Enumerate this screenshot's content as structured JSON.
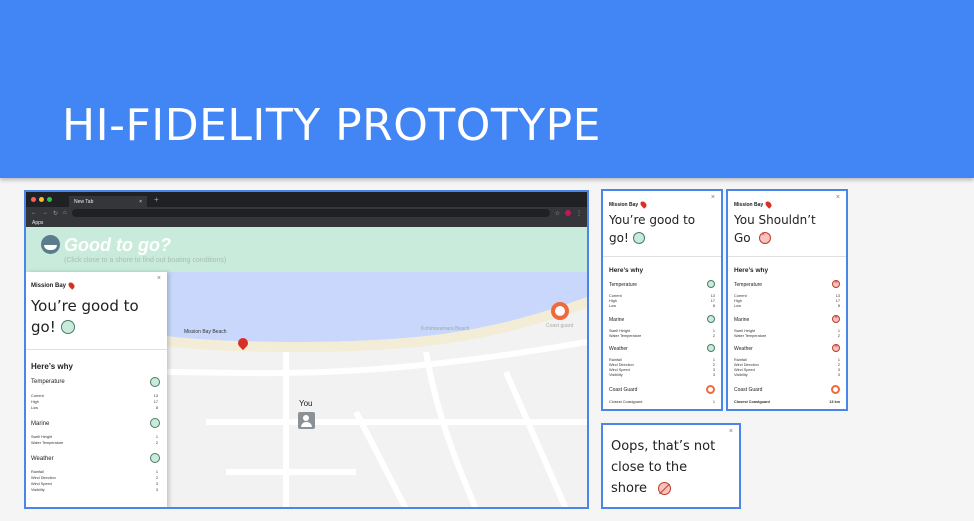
{
  "banner": {
    "title": "HI-FIDELITY PROTOTYPE"
  },
  "browser": {
    "tab_label": "New Tab",
    "tab_close": "×",
    "new_tab": "+",
    "bookmark": "Apps",
    "app_title": "Good to go?",
    "app_subtitle": "(Click close to a shore to find out boating conditions)"
  },
  "map": {
    "beach_label": "Mission Bay Beach",
    "faded_label": "Kohimaramara Beach",
    "coast_guard": "Coast guard",
    "you_label": "You"
  },
  "main_panel": {
    "close": "×",
    "location": "Mission Bay",
    "headline_1": "You’re good to",
    "headline_2": "go!",
    "heres_why": "Here’s why",
    "temperature": "Temperature",
    "temp_rows": [
      {
        "label": "Current",
        "value": "13"
      },
      {
        "label": "High",
        "value": "17"
      },
      {
        "label": "Low",
        "value": "8"
      }
    ],
    "marine": "Marine",
    "marine_rows": [
      {
        "label": "Swell Height",
        "value": "1"
      },
      {
        "label": "Water Temperature",
        "value": "2"
      }
    ],
    "weather": "Weather",
    "weather_rows": [
      {
        "label": "Rainfall",
        "value": "1"
      },
      {
        "label": "Wind Direction",
        "value": "2"
      },
      {
        "label": "Wind Speed",
        "value": "3"
      },
      {
        "label": "Visibility",
        "value": "3"
      }
    ]
  },
  "card_good": {
    "close": "×",
    "location": "Mission Bay",
    "headline_1": "You’re good to",
    "headline_2": "go!",
    "heres_why": "Here’s why",
    "temperature": "Temperature",
    "temp_rows": [
      {
        "label": "Current",
        "value": "13"
      },
      {
        "label": "High",
        "value": "17"
      },
      {
        "label": "Low",
        "value": "8"
      }
    ],
    "marine": "Marine",
    "marine_rows": [
      {
        "label": "Swell Height",
        "value": "1"
      },
      {
        "label": "Water Temperature",
        "value": "2"
      }
    ],
    "weather": "Weather",
    "weather_rows": [
      {
        "label": "Rainfall",
        "value": "1"
      },
      {
        "label": "Wind Direction",
        "value": "2"
      },
      {
        "label": "Wind Speed",
        "value": "3"
      },
      {
        "label": "Visibility",
        "value": "3"
      }
    ],
    "coast_guard": "Coast Guard",
    "coast_row": {
      "label": "Closest Coastguard",
      "value": "1"
    }
  },
  "card_bad": {
    "close": "×",
    "location": "Mission Bay",
    "headline_1": "You Shouldn’t",
    "headline_2": "Go",
    "heres_why": "Here’s why",
    "temperature": "Temperature",
    "temp_rows": [
      {
        "label": "Current",
        "value": "13"
      },
      {
        "label": "High",
        "value": "17"
      },
      {
        "label": "Low",
        "value": "8"
      }
    ],
    "marine": "Marine",
    "marine_rows": [
      {
        "label": "Swell Height",
        "value": "1"
      },
      {
        "label": "Water Temperature",
        "value": "2"
      }
    ],
    "weather": "Weather",
    "weather_rows": [
      {
        "label": "Rainfall",
        "value": "1"
      },
      {
        "label": "Wind Direction",
        "value": "2"
      },
      {
        "label": "Wind Speed",
        "value": "3"
      },
      {
        "label": "Visibility",
        "value": "3"
      }
    ],
    "coast_guard": "Coast Guard",
    "coast_row": {
      "label": "Closest Coastguard",
      "value": "13 km"
    }
  },
  "card_oops": {
    "close": "×",
    "line_1": "Oops, that’s not",
    "line_2": "close to the",
    "line_3": "shore"
  },
  "colors": {
    "banner": "#4285f4",
    "frame": "#4a86e8",
    "good": "#c8ebdc",
    "bad": "#f6c3bd",
    "coast": "#f0693c"
  }
}
